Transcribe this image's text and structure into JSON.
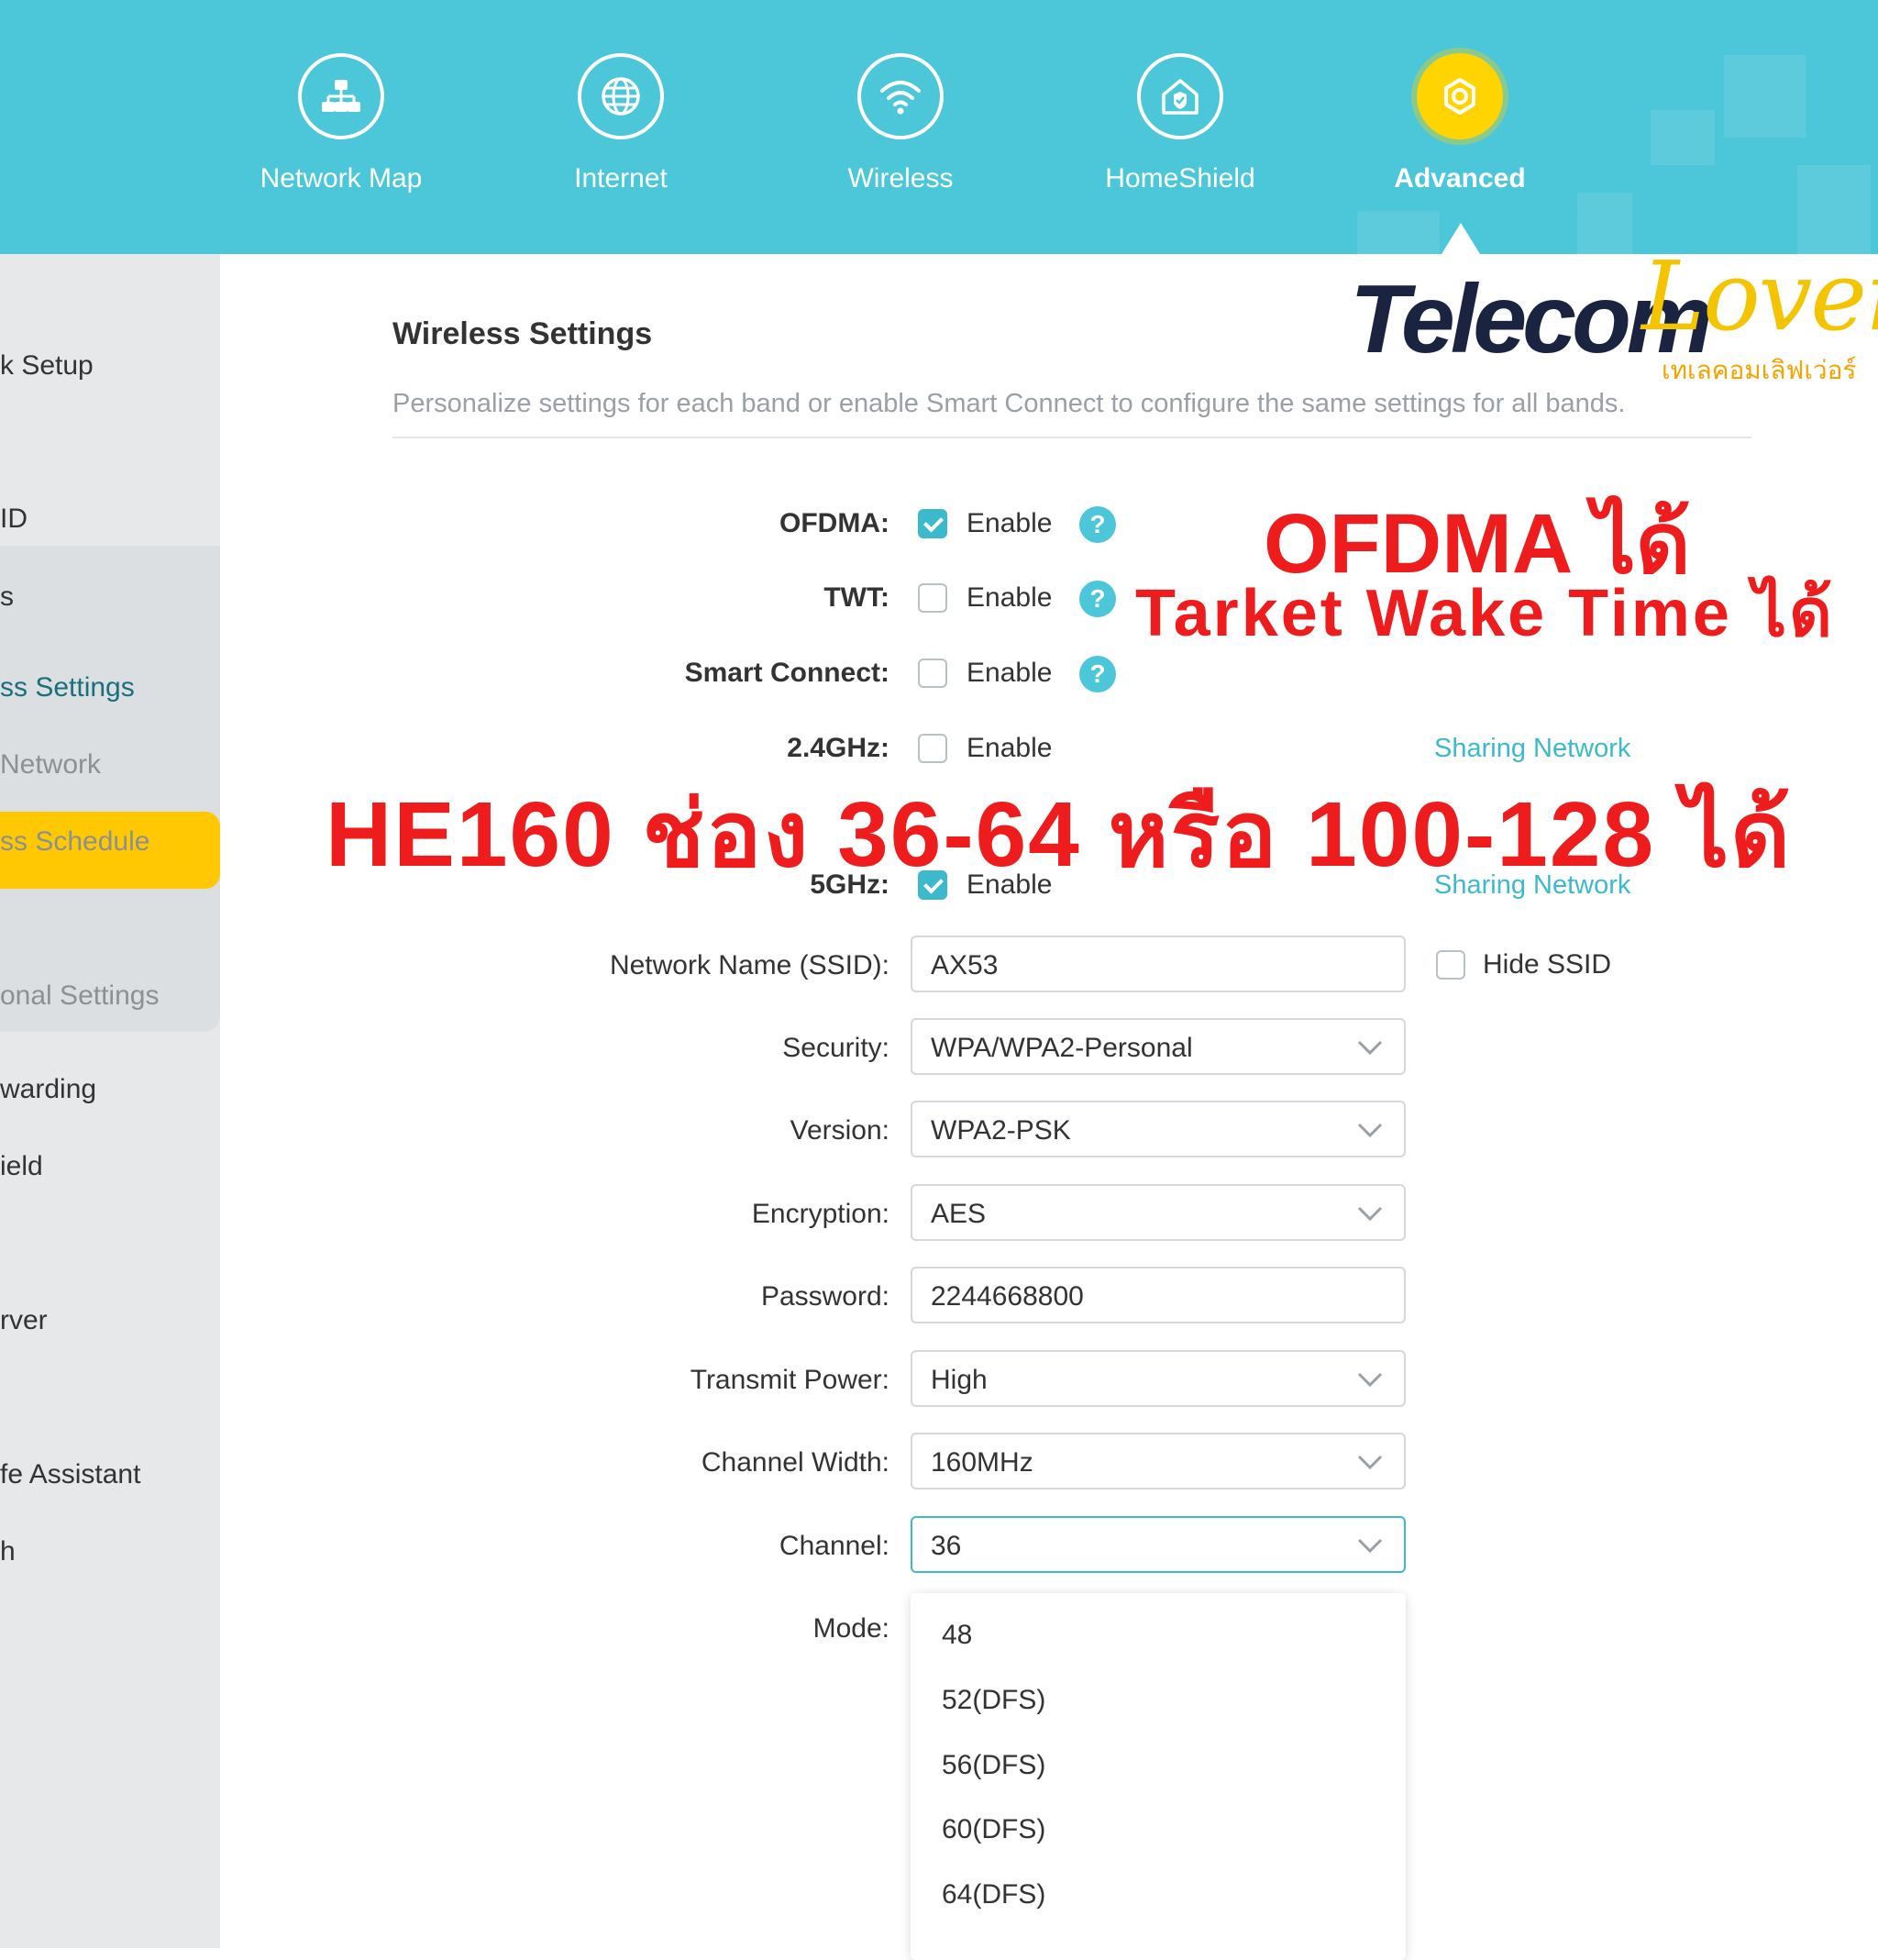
{
  "nav": {
    "items": [
      {
        "label": "Network Map",
        "icon": "network-map-icon"
      },
      {
        "label": "Internet",
        "icon": "globe-icon"
      },
      {
        "label": "Wireless",
        "icon": "wifi-icon"
      },
      {
        "label": "HomeShield",
        "icon": "home-shield-icon"
      },
      {
        "label": "Advanced",
        "icon": "gear-icon",
        "active": true
      }
    ]
  },
  "sidebar": {
    "items": [
      {
        "label": "k Setup"
      },
      {
        "label": "ID"
      },
      {
        "label": "s",
        "active": true
      },
      {
        "label": "ss Settings",
        "current": true
      },
      {
        "label": "Network"
      },
      {
        "label": "ss Schedule"
      },
      {
        "label": "onal Settings"
      },
      {
        "label": "warding"
      },
      {
        "label": "ield"
      },
      {
        "label": "rver"
      },
      {
        "label": "fe Assistant"
      },
      {
        "label": "h"
      }
    ]
  },
  "main": {
    "title": "Wireless Settings",
    "description": "Personalize settings for each band or enable Smart Connect to configure the same settings for all bands.",
    "options": {
      "ofdma": {
        "label": "OFDMA",
        "checkbox": "Enable",
        "checked": true
      },
      "twt": {
        "label": "TWT",
        "checkbox": "Enable",
        "checked": false
      },
      "smart_connect": {
        "label": "Smart Connect",
        "checkbox": "Enable",
        "checked": false
      },
      "band24": {
        "label": "2.4GHz",
        "checkbox": "Enable",
        "checked": false,
        "link": "Sharing Network"
      },
      "band5": {
        "label": "5GHz",
        "checkbox": "Enable",
        "checked": true,
        "link": "Sharing Network"
      }
    },
    "help_glyph": "?",
    "form": {
      "ssid": {
        "label": "Network Name (SSID):",
        "value": "AX53",
        "hide_label": "Hide SSID"
      },
      "security": {
        "label": "Security:",
        "value": "WPA/WPA2-Personal"
      },
      "version": {
        "label": "Version:",
        "value": "WPA2-PSK"
      },
      "encryption": {
        "label": "Encryption:",
        "value": "AES"
      },
      "password": {
        "label": "Password:",
        "value": "2244668800"
      },
      "transmit_power": {
        "label": "Transmit Power:",
        "value": "High"
      },
      "channel_width": {
        "label": "Channel Width:",
        "value": "160MHz"
      },
      "channel": {
        "label": "Channel:",
        "value": "36"
      },
      "mode": {
        "label": "Mode:"
      }
    },
    "channel_options": [
      "48",
      "52(DFS)",
      "56(DFS)",
      "60(DFS)",
      "64(DFS)"
    ]
  },
  "overlay": {
    "logo_main": "Telecom",
    "logo_script": "Lover",
    "logo_thai": "เทเลคอมเลิฟเว่อร์",
    "line1": "OFDMA ได้",
    "line2": "Tarket Wake Time ได้",
    "line3": "HE160 ช่อง 36-64 หรือ 100-128 ได้"
  },
  "colors": {
    "accent": "#4cc6d9",
    "active_nav": "#ffd400",
    "sidebar_active": "#ffc800",
    "overlay_text": "#ee1c1c"
  }
}
